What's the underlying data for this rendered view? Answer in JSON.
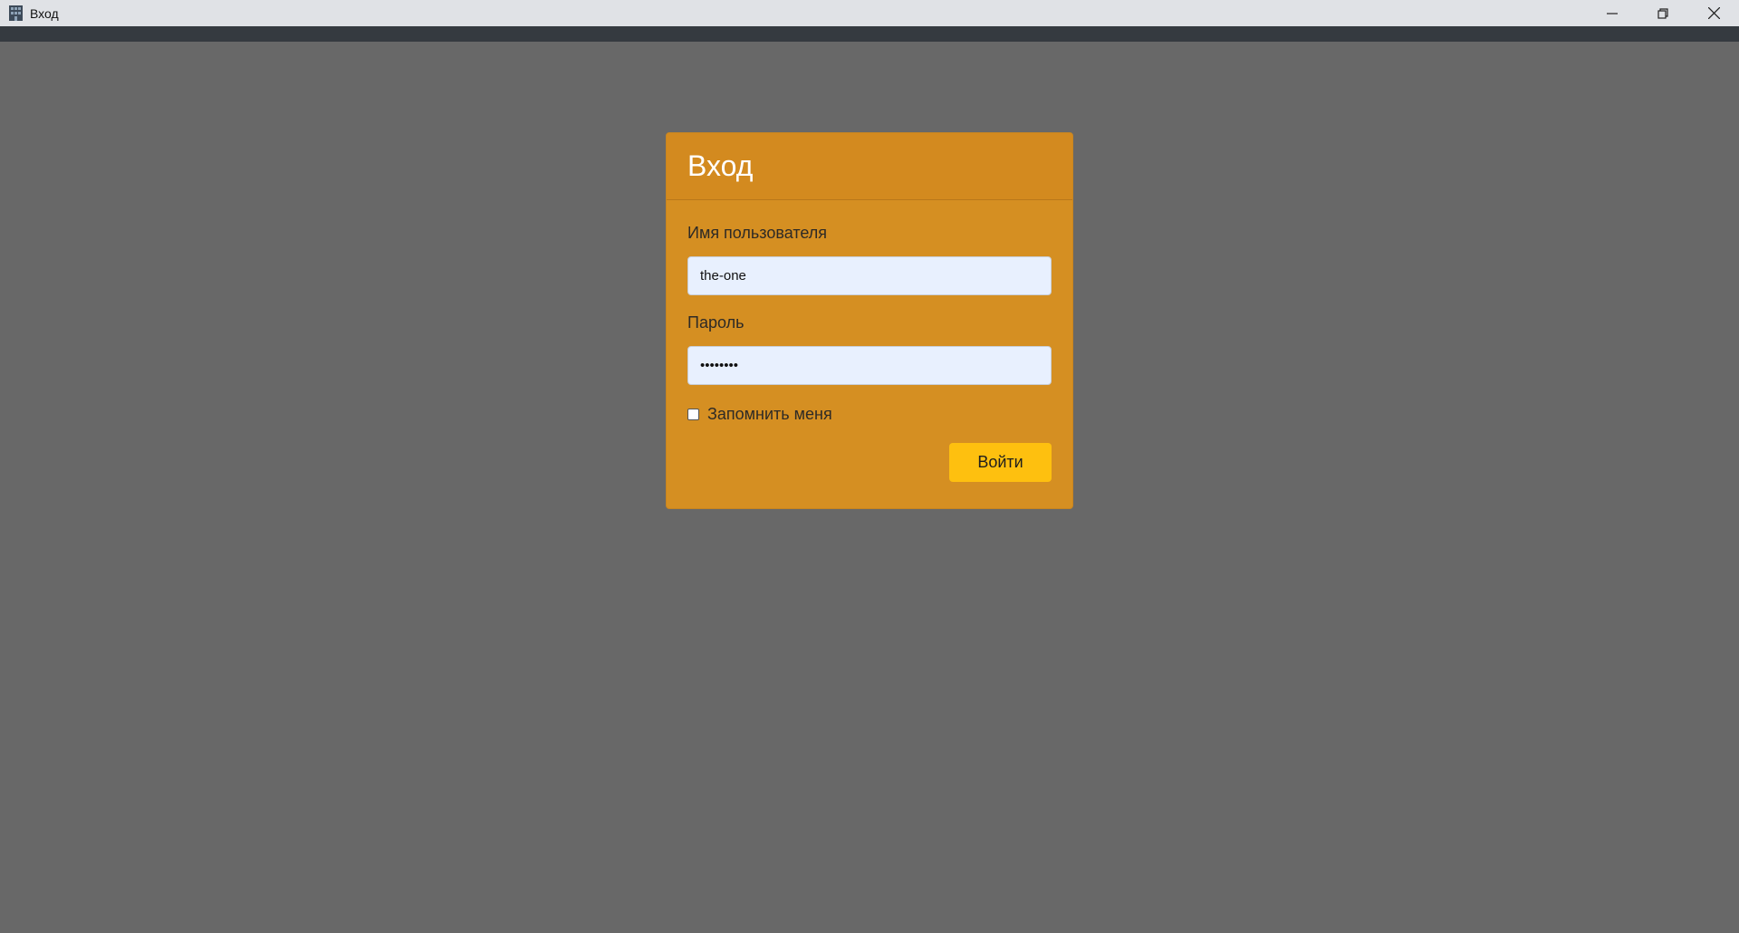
{
  "window": {
    "title": "Вход",
    "app_icon": "building-icon",
    "controls": [
      "minimize-icon",
      "restore-icon",
      "close-icon"
    ]
  },
  "card": {
    "title": "Вход",
    "username_label": "Имя пользователя",
    "username_value": "the-one",
    "password_label": "Пароль",
    "password_value": "••••••••",
    "remember_label": "Запомнить меня",
    "remember_checked": false,
    "submit_label": "Войти"
  },
  "colors": {
    "page_background": "#686868",
    "card": "#d58f22",
    "button": "#fec00f",
    "input": "#e8f0fe"
  }
}
